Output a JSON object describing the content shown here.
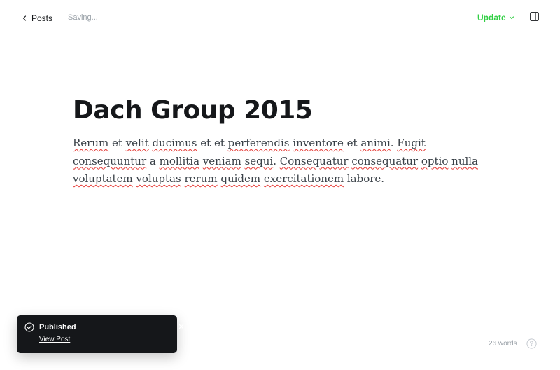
{
  "header": {
    "back_label": "Posts",
    "status": "Saving...",
    "update_label": "Update"
  },
  "icons": {
    "back": "chevron-left-icon",
    "update_menu": "chevron-down-icon",
    "sidebar": "sidebar-toggle-icon",
    "toast_status": "check-circle-icon",
    "toast_close": "close-icon",
    "help": "help-circle-icon"
  },
  "colors": {
    "accent": "#30cf43",
    "spellcheck": "#e53935",
    "toast_bg": "#15171a"
  },
  "editor": {
    "title": "Dach Group 2015",
    "body_words": [
      {
        "t": "Rerum",
        "sp": true
      },
      {
        "t": " et ",
        "sp": false
      },
      {
        "t": "velit",
        "sp": true
      },
      {
        "t": " ",
        "sp": false
      },
      {
        "t": "ducimus",
        "sp": true
      },
      {
        "t": " et et ",
        "sp": false
      },
      {
        "t": "perferendis",
        "sp": true
      },
      {
        "t": " ",
        "sp": false
      },
      {
        "t": "inventore",
        "sp": true
      },
      {
        "t": " et ",
        "sp": false
      },
      {
        "t": "animi",
        "sp": true
      },
      {
        "t": ". ",
        "sp": false
      },
      {
        "t": "Fugit",
        "sp": true
      },
      {
        "t": " ",
        "sp": false
      },
      {
        "t": "consequuntur",
        "sp": true
      },
      {
        "t": " a ",
        "sp": false
      },
      {
        "t": "mollitia",
        "sp": true
      },
      {
        "t": " ",
        "sp": false
      },
      {
        "t": "veniam",
        "sp": true
      },
      {
        "t": " ",
        "sp": false
      },
      {
        "t": "sequi",
        "sp": true
      },
      {
        "t": ". ",
        "sp": false
      },
      {
        "t": "Consequatur",
        "sp": true
      },
      {
        "t": " ",
        "sp": false
      },
      {
        "t": "consequatur",
        "sp": true
      },
      {
        "t": " ",
        "sp": false
      },
      {
        "t": "optio",
        "sp": true
      },
      {
        "t": " ",
        "sp": false
      },
      {
        "t": "nulla",
        "sp": true
      },
      {
        "t": " ",
        "sp": false
      },
      {
        "t": "voluptatem",
        "sp": true
      },
      {
        "t": " ",
        "sp": false
      },
      {
        "t": "voluptas",
        "sp": true
      },
      {
        "t": " ",
        "sp": false
      },
      {
        "t": "rerum",
        "sp": true
      },
      {
        "t": " ",
        "sp": false
      },
      {
        "t": "quidem",
        "sp": true
      },
      {
        "t": " ",
        "sp": false
      },
      {
        "t": "exercitationem",
        "sp": true
      },
      {
        "t": " labore.",
        "sp": false
      }
    ]
  },
  "toast": {
    "title": "Published",
    "link": "View Post"
  },
  "footer": {
    "word_count": "26 words"
  }
}
